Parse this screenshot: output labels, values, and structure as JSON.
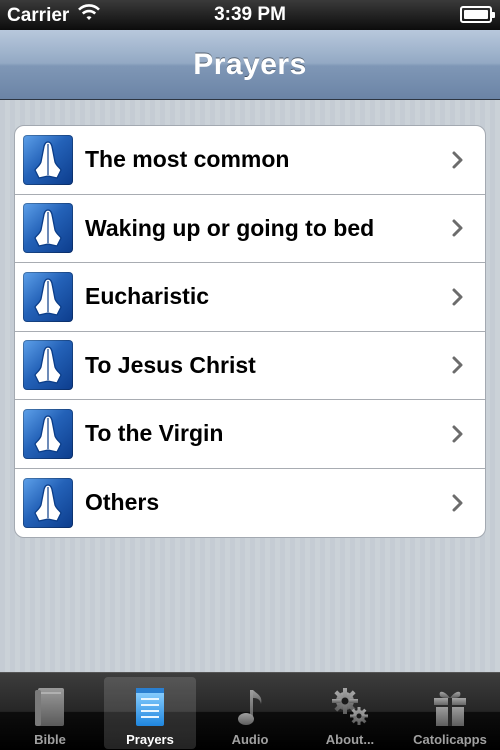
{
  "status": {
    "carrier": "Carrier",
    "time": "3:39 PM",
    "battery": 1.0
  },
  "nav": {
    "title": "Prayers"
  },
  "rows": [
    {
      "label": "The most common",
      "icon": "praying-hands-icon"
    },
    {
      "label": "Waking up or going to bed",
      "icon": "praying-hands-icon"
    },
    {
      "label": "Eucharistic",
      "icon": "praying-hands-icon"
    },
    {
      "label": "To Jesus Christ",
      "icon": "praying-hands-icon"
    },
    {
      "label": "To the Virgin",
      "icon": "praying-hands-icon"
    },
    {
      "label": "Others",
      "icon": "praying-hands-icon"
    }
  ],
  "tabs": [
    {
      "label": "Bible",
      "icon": "book-icon",
      "selected": false
    },
    {
      "label": "Prayers",
      "icon": "notepad-icon",
      "selected": true
    },
    {
      "label": "Audio",
      "icon": "music-note-icon",
      "selected": false
    },
    {
      "label": "About...",
      "icon": "gears-icon",
      "selected": false
    },
    {
      "label": "Catolicapps",
      "icon": "gift-icon",
      "selected": false
    }
  ],
  "colors": {
    "nav_gradient_top": "#b8c8dc",
    "nav_gradient_bottom": "#6b84a6",
    "icon_blue": "#2462b8",
    "tab_selected_blue": "#3aa6f0",
    "pinstripe": "#c5ccd4"
  }
}
